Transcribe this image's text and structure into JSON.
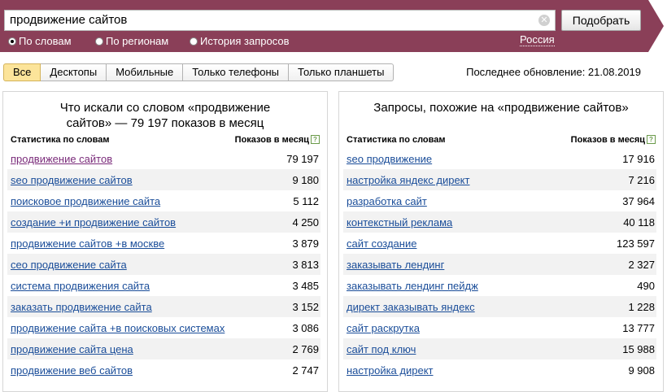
{
  "search": {
    "query": "продвижение сайтов",
    "submit_label": "Подобрать",
    "modes": [
      {
        "label": "По словам",
        "selected": true
      },
      {
        "label": "По регионам",
        "selected": false
      },
      {
        "label": "История запросов",
        "selected": false
      }
    ],
    "region": "Россия"
  },
  "colors": {
    "banner": "#8a3f58",
    "accent_tab": "#fce49a",
    "link": "#1a4d99"
  },
  "tabs": [
    {
      "label": "Все",
      "active": true
    },
    {
      "label": "Десктопы",
      "active": false
    },
    {
      "label": "Мобильные",
      "active": false
    },
    {
      "label": "Только телефоны",
      "active": false
    },
    {
      "label": "Только планшеты",
      "active": false
    }
  ],
  "last_update": "Последнее обновление: 21.08.2019",
  "left": {
    "title": "Что искали со словом «продвижение сайтов» — 79 197 показов в месяц",
    "col_stats": "Статистика по словам",
    "col_views": "Показов в месяц",
    "rows": [
      {
        "q": "продвижение сайтов",
        "n": "79 197"
      },
      {
        "q": "seo продвижение сайтов",
        "n": "9 180"
      },
      {
        "q": "поисковое продвижение сайта",
        "n": "5 112"
      },
      {
        "q": "создание +и продвижение сайтов",
        "n": "4 250"
      },
      {
        "q": "продвижение сайтов +в москве",
        "n": "3 879"
      },
      {
        "q": "сео продвижение сайта",
        "n": "3 813"
      },
      {
        "q": "система продвижения сайта",
        "n": "3 485"
      },
      {
        "q": "заказать продвижение сайта",
        "n": "3 152"
      },
      {
        "q": "продвижение сайта +в поисковых системах",
        "n": "3 086"
      },
      {
        "q": "продвижение сайта цена",
        "n": "2 769"
      },
      {
        "q": "продвижение веб сайтов",
        "n": "2 747"
      }
    ]
  },
  "right": {
    "title": "Запросы, похожие на «продвижение сайтов»",
    "col_stats": "Статистика по словам",
    "col_views": "Показов в месяц",
    "rows": [
      {
        "q": "seo продвижение",
        "n": "17 916"
      },
      {
        "q": "настройка яндекс директ",
        "n": "7 216"
      },
      {
        "q": "разработка сайт",
        "n": "37 964"
      },
      {
        "q": "контекстный реклама",
        "n": "40 118"
      },
      {
        "q": "сайт создание",
        "n": "123 597"
      },
      {
        "q": "заказывать лендинг",
        "n": "2 327"
      },
      {
        "q": "заказывать лендинг пейдж",
        "n": "490"
      },
      {
        "q": "директ заказывать яндекс",
        "n": "1 228"
      },
      {
        "q": "сайт раскрутка",
        "n": "13 777"
      },
      {
        "q": "сайт под ключ",
        "n": "15 988"
      },
      {
        "q": "настройка директ",
        "n": "9 908"
      }
    ]
  }
}
